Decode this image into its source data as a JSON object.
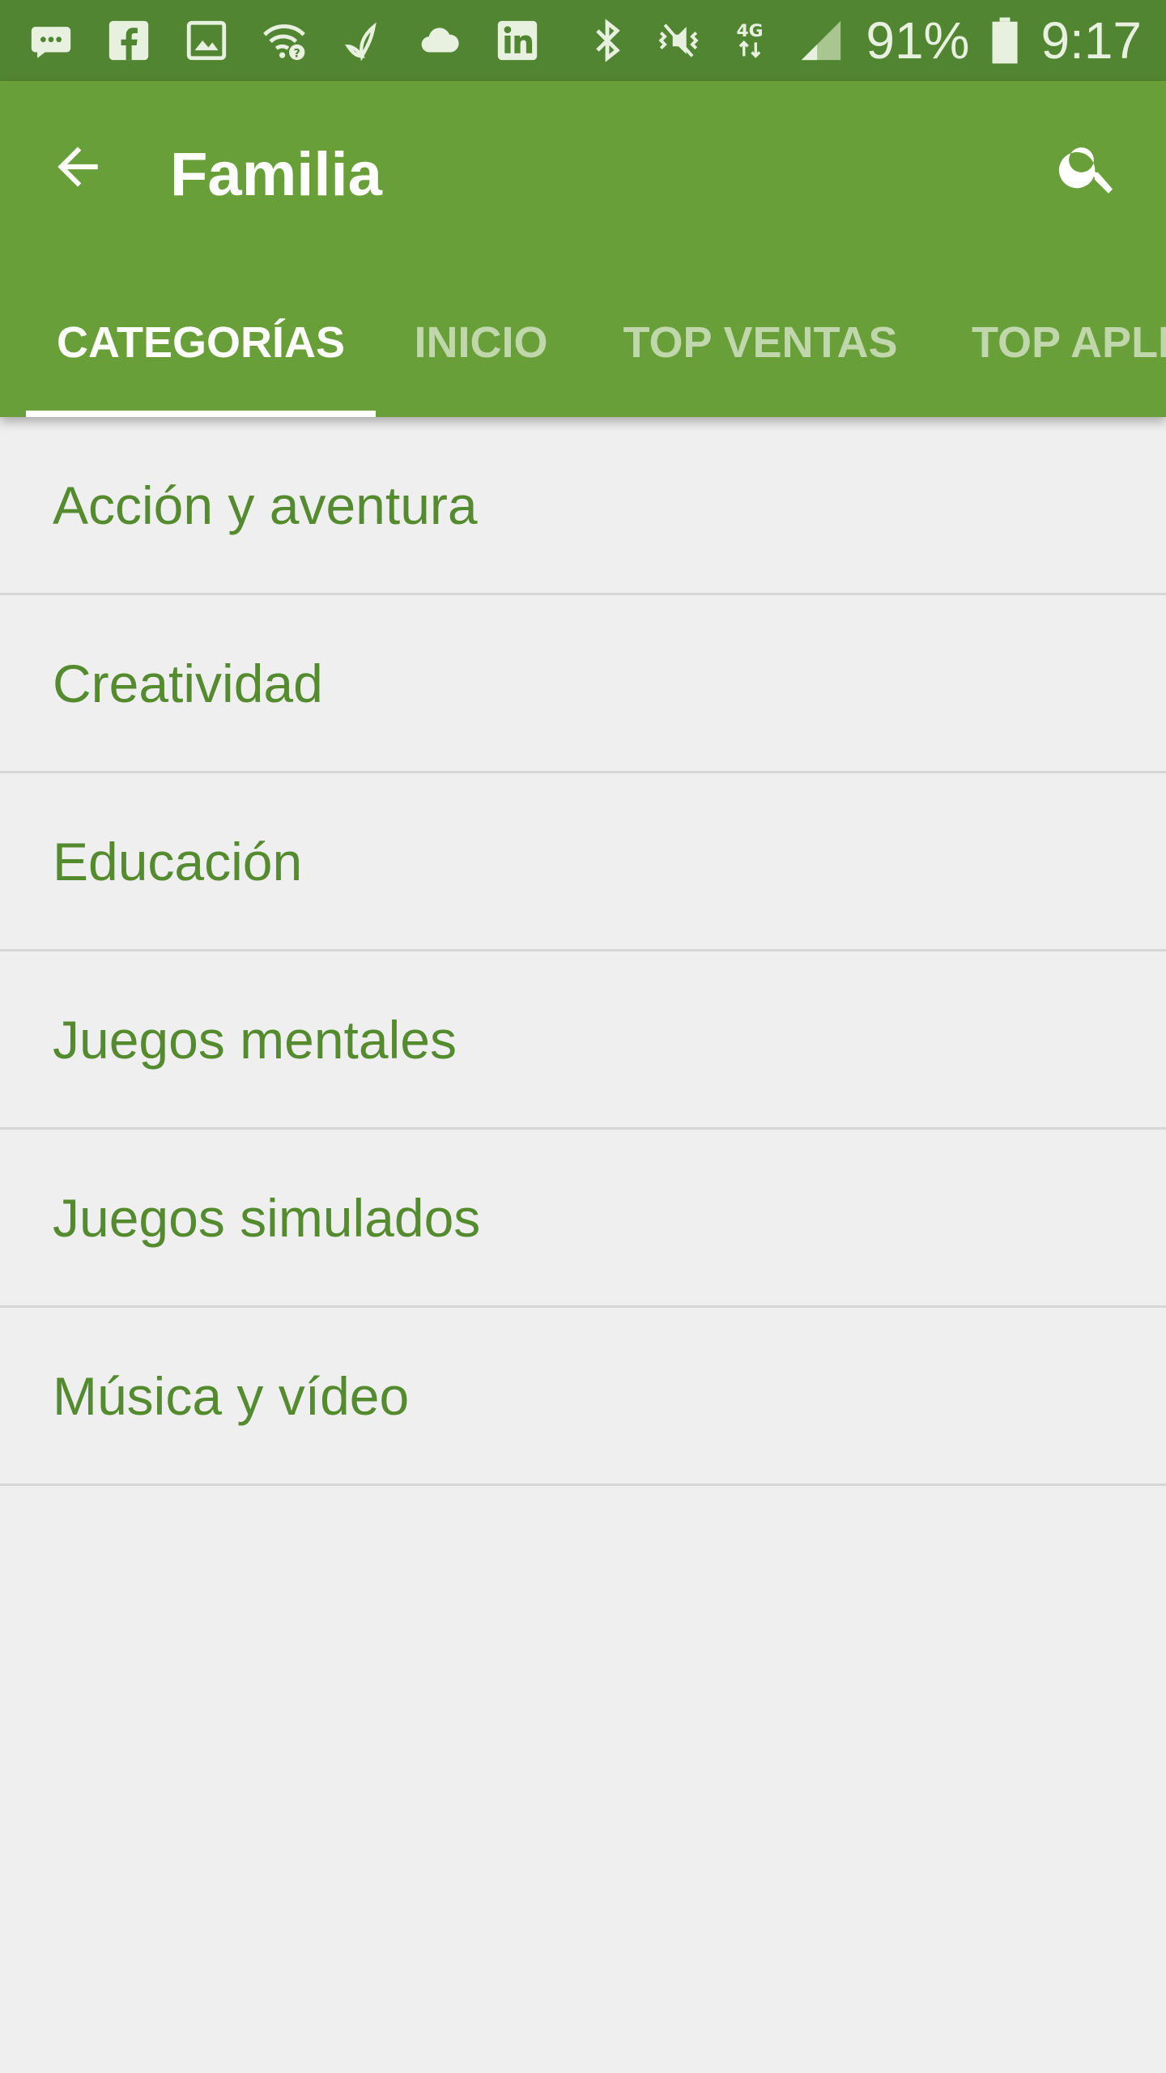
{
  "status_bar": {
    "battery_percent": "91%",
    "time": "9:17",
    "network_label": "4G",
    "left_icons": [
      "message-icon",
      "facebook-icon",
      "gallery-icon",
      "wifi-question-icon",
      "butterfly-icon",
      "cloud-icon",
      "linkedin-icon"
    ],
    "right_icons": [
      "bluetooth-icon",
      "vibrate-mute-icon",
      "signal-icon",
      "battery-icon"
    ]
  },
  "app_bar": {
    "title": "Familia",
    "back_icon": "arrow-back-icon",
    "search_icon": "search-icon",
    "background_color": "#689f38"
  },
  "tabs": [
    {
      "label": "CATEGORÍAS",
      "active": true
    },
    {
      "label": "INICIO",
      "active": false
    },
    {
      "label": "TOP VENTAS",
      "active": false
    },
    {
      "label": "TOP APLI",
      "active": false
    }
  ],
  "categories": [
    {
      "label": "Acción y aventura"
    },
    {
      "label": "Creatividad"
    },
    {
      "label": "Educación"
    },
    {
      "label": "Juegos mentales"
    },
    {
      "label": "Juegos simulados"
    },
    {
      "label": "Música y vídeo"
    }
  ],
  "colors": {
    "status_bar": "#528531",
    "primary": "#689f38",
    "list_text": "#558b2f",
    "background": "#efefef"
  }
}
